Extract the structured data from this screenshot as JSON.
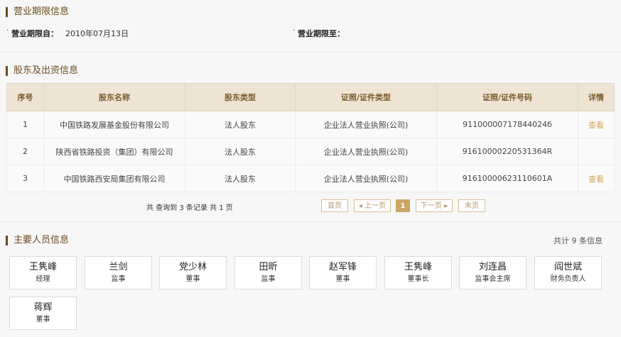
{
  "business_period": {
    "title": "营业期限信息",
    "from_label": "营业期限自：",
    "from_value": "2010年07月13日",
    "to_label": "营业期限至："
  },
  "shareholders": {
    "title": "股东及出资信息",
    "columns": [
      "序号",
      "股东名称",
      "股东类型",
      "证照/证件类型",
      "证照/证件号码",
      "详情"
    ],
    "rows": [
      [
        "1",
        "中国铁路发展基金股份有限公司",
        "法人股东",
        "企业法人营业执照(公司)",
        "91100000717844024б",
        "查看"
      ],
      [
        "2",
        "陕西省铁路投资（集团）有限公司",
        "法人股东",
        "企业法人营业执照(公司)",
        "91610000220531364R",
        ""
      ],
      [
        "3",
        "中国铁路西安局集团有限公司",
        "法人股东",
        "企业法人营业执照(公司)",
        "91610000623110601A",
        "查看"
      ]
    ],
    "pager": {
      "info": "共 查询到 3 条记录 共 1 页",
      "first": "首页",
      "prev": "◂ 上一页",
      "current": "1",
      "next": "下一页 ▸",
      "last": "末页"
    }
  },
  "personnel": {
    "title": "主要人员信息",
    "count": "共计 9 条信息",
    "people": [
      {
        "name": "王隽峰",
        "position": "经理"
      },
      {
        "name": "兰剑",
        "position": "监事"
      },
      {
        "name": "党少林",
        "position": "董事"
      },
      {
        "name": "田昕",
        "position": "监事"
      },
      {
        "name": "赵军锋",
        "position": "董事"
      },
      {
        "name": "王隽峰",
        "position": "董事长"
      },
      {
        "name": "刘连昌",
        "position": "监事会主席"
      },
      {
        "name": "阎世斌",
        "position": "财务负责人"
      },
      {
        "name": "蒋辉",
        "position": "董事"
      }
    ]
  }
}
